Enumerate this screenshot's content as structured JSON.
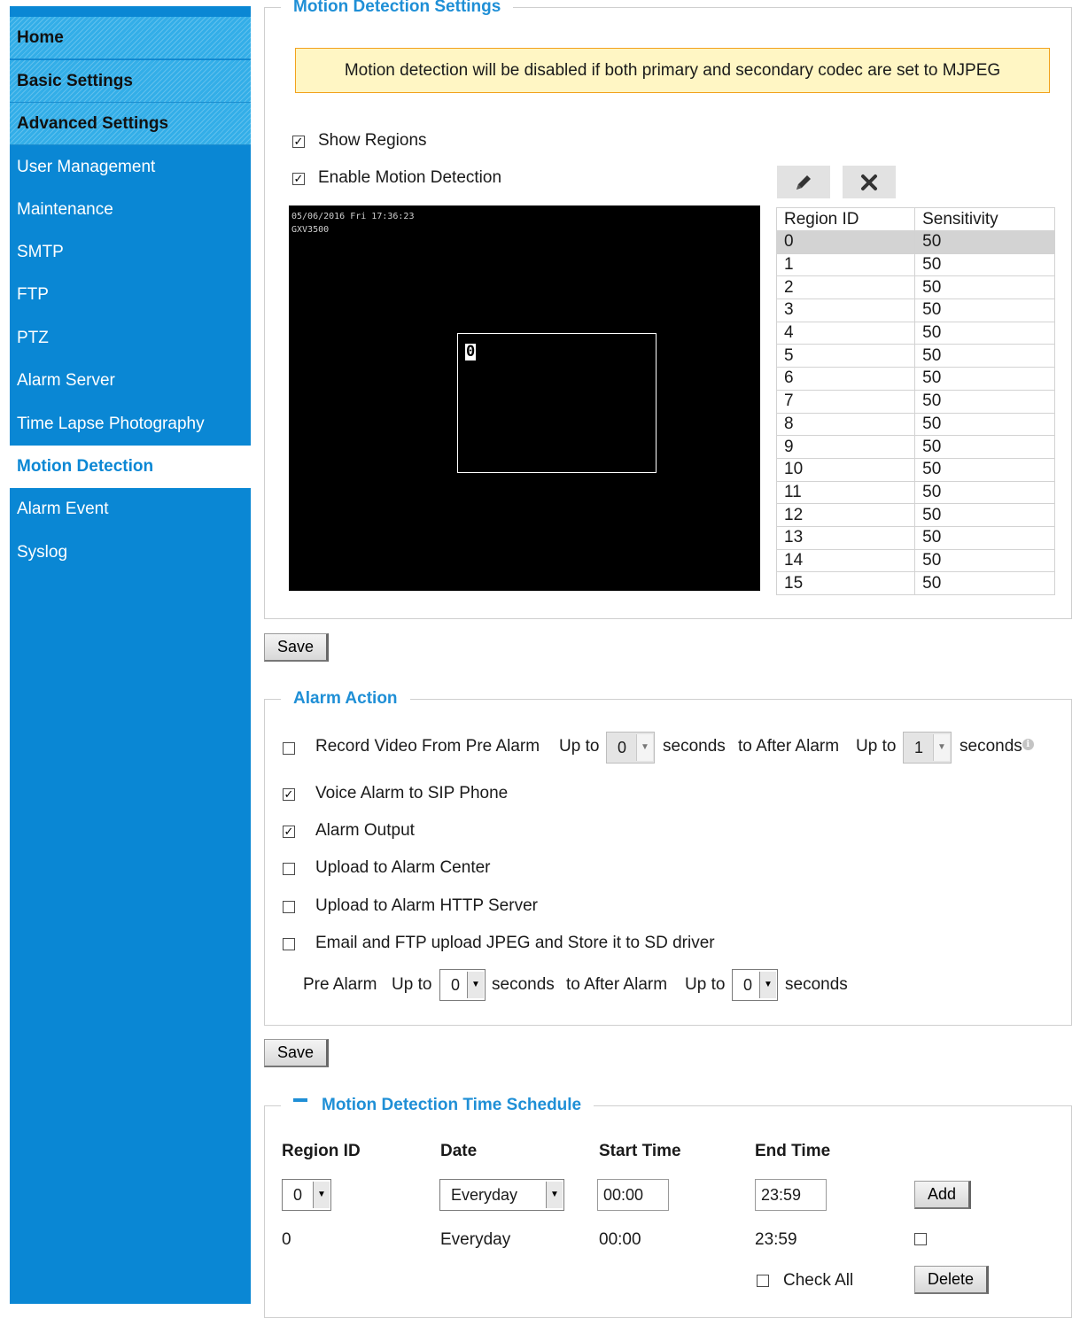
{
  "sidebar": {
    "items": [
      {
        "label": "Home"
      },
      {
        "label": "Basic Settings"
      },
      {
        "label": "Advanced Settings"
      },
      {
        "label": "User Management"
      },
      {
        "label": "Maintenance"
      },
      {
        "label": "SMTP"
      },
      {
        "label": "FTP"
      },
      {
        "label": "PTZ"
      },
      {
        "label": "Alarm Server"
      },
      {
        "label": "Time Lapse Photography"
      },
      {
        "label": "Motion Detection"
      },
      {
        "label": "Alarm Event"
      },
      {
        "label": "Syslog"
      }
    ],
    "active": "Motion Detection"
  },
  "motion": {
    "title": "Motion Detection Settings",
    "notice": "Motion detection will be disabled if both primary and secondary codec are set to MJPEG",
    "show_regions": {
      "label": "Show Regions",
      "checked": true
    },
    "enable_motion": {
      "label": "Enable Motion Detection",
      "checked": true
    },
    "edit_icon": "pencil-icon",
    "delete_icon": "close-icon",
    "video": {
      "timestamp": "05/06/2016 Fri 17:36:23",
      "camera_name": "GXV3500",
      "region_label": "0"
    },
    "table": {
      "headers": [
        "Region ID",
        "Sensitivity"
      ],
      "selected_row": 0,
      "rows": [
        [
          "0",
          "50"
        ],
        [
          "1",
          "50"
        ],
        [
          "2",
          "50"
        ],
        [
          "3",
          "50"
        ],
        [
          "4",
          "50"
        ],
        [
          "5",
          "50"
        ],
        [
          "6",
          "50"
        ],
        [
          "7",
          "50"
        ],
        [
          "8",
          "50"
        ],
        [
          "9",
          "50"
        ],
        [
          "10",
          "50"
        ],
        [
          "11",
          "50"
        ],
        [
          "12",
          "50"
        ],
        [
          "13",
          "50"
        ],
        [
          "14",
          "50"
        ],
        [
          "15",
          "50"
        ]
      ]
    }
  },
  "save_label": "Save",
  "alarm": {
    "title": "Alarm Action",
    "record": {
      "checked": false,
      "label": "Record Video From Pre Alarm",
      "up_to": "Up to",
      "pre_value": "0",
      "seconds": "seconds",
      "after_label": "to After Alarm",
      "up_to2": "Up to",
      "post_value": "1",
      "seconds2": "seconds",
      "info_icon": "info-icon"
    },
    "voice_sip": {
      "label": "Voice Alarm to SIP Phone",
      "checked": true
    },
    "alarm_output": {
      "label": "Alarm Output",
      "checked": true
    },
    "alarm_center": {
      "label": "Upload to Alarm Center",
      "checked": false
    },
    "http_server": {
      "label": "Upload to Alarm HTTP Server",
      "checked": false
    },
    "email_ftp": {
      "label": "Email and FTP upload JPEG and Store it to SD driver",
      "checked": false
    },
    "pre_alarm": {
      "label": "Pre Alarm",
      "up_to": "Up to",
      "pre_value": "0",
      "seconds": "seconds",
      "after_label": "to After Alarm",
      "up_to2": "Up to",
      "post_value": "0",
      "seconds2": "seconds"
    }
  },
  "schedule": {
    "title": "Motion Detection Time Schedule",
    "collapse_icon": "minus-icon",
    "headers": {
      "region": "Region ID",
      "date": "Date",
      "start": "Start Time",
      "end": "End Time"
    },
    "form": {
      "region": "0",
      "date": "Everyday",
      "start": "00:00",
      "end": "23:59",
      "add_label": "Add"
    },
    "rows": [
      {
        "region": "0",
        "date": "Everyday",
        "start": "00:00",
        "end": "23:59",
        "checked": false
      }
    ],
    "check_all_label": "Check All",
    "delete_label": "Delete"
  }
}
